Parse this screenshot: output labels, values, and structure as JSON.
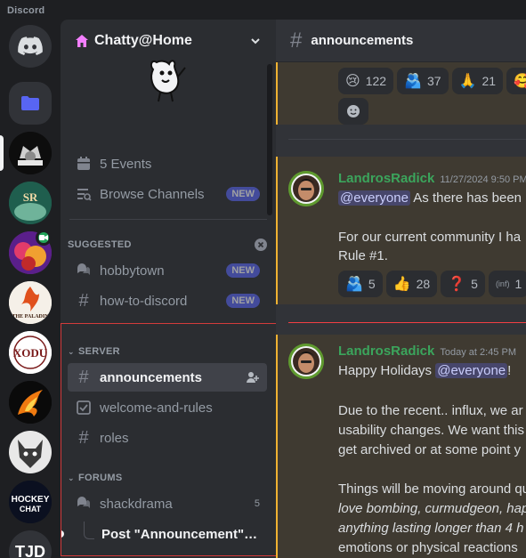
{
  "window": {
    "wordmark": "Discord"
  },
  "guild": {
    "name": "Chatty@Home"
  },
  "sidebar": {
    "events_label": "5 Events",
    "browse_label": "Browse Channels",
    "new_label": "NEW",
    "suggested_title": "SUGGESTED",
    "suggested": [
      {
        "label": "hobbytown",
        "badge": "NEW"
      },
      {
        "label": "how-to-discord",
        "badge": "NEW"
      }
    ],
    "server_title": "SERVER",
    "server_channels": [
      "announcements",
      "welcome-and-rules",
      "roles"
    ],
    "forums_title": "FORUMS",
    "forum": {
      "label": "shackdrama",
      "count": "5"
    },
    "thread": {
      "label": "Post \"Announcement\" S..."
    }
  },
  "servers": [
    {
      "name": "home",
      "icon": "discord-logo-icon"
    },
    {
      "name": "folder",
      "icon": "folder-icon"
    },
    {
      "name": "server-1"
    },
    {
      "name": "server-2",
      "text": "SR"
    },
    {
      "name": "server-3"
    },
    {
      "name": "server-4",
      "text": "THE PALADIN"
    },
    {
      "name": "server-5",
      "text": "XODU"
    },
    {
      "name": "server-6"
    },
    {
      "name": "server-7"
    },
    {
      "name": "server-8",
      "text": "HOCKEY CHAT"
    },
    {
      "name": "server-9",
      "text": "TJD"
    }
  ],
  "channel": {
    "name": "announcements"
  },
  "messages": {
    "top_reactions": [
      {
        "emoji": "😢",
        "count": "122"
      },
      {
        "emoji": "🫂",
        "count": "37"
      },
      {
        "emoji": "🙏",
        "count": "21"
      },
      {
        "emoji": "🥰",
        "count": ""
      }
    ],
    "m1": {
      "author": "LandrosRadick",
      "time": "11/27/2024 9:50 PM",
      "mention": "@everyone",
      "line1_rest": " As there has been",
      "line2": "For our current community I ha",
      "line3": "Rule #1.",
      "reactions": [
        {
          "emoji": "🫂",
          "count": "5"
        },
        {
          "emoji": "👍",
          "count": "28"
        },
        {
          "emoji": "❓",
          "count": "5"
        },
        {
          "emoji": "(inf)",
          "count": "1"
        }
      ]
    },
    "m2": {
      "author": "LandrosRadick",
      "time": "Today at 2:45 PM",
      "line1_pre": "Happy Holidays ",
      "mention": "@everyone",
      "line1_post": "!",
      "p1": [
        "Due to the recent.. influx, we ar",
        "usability changes. We want this",
        "get archived or at some point y"
      ],
      "p2_l1": "Things will be moving around qu",
      "p2_l2": "love bombing, curmudgeon, hap",
      "p2_l3": "anything lasting longer than 4 h",
      "p2_l4": "emotions or physical reactions"
    }
  },
  "colors": {
    "accent": "#5865f2",
    "author": "#3ba55c",
    "highlight_bar": "#f0b232",
    "new_divider": "#f23f43"
  }
}
